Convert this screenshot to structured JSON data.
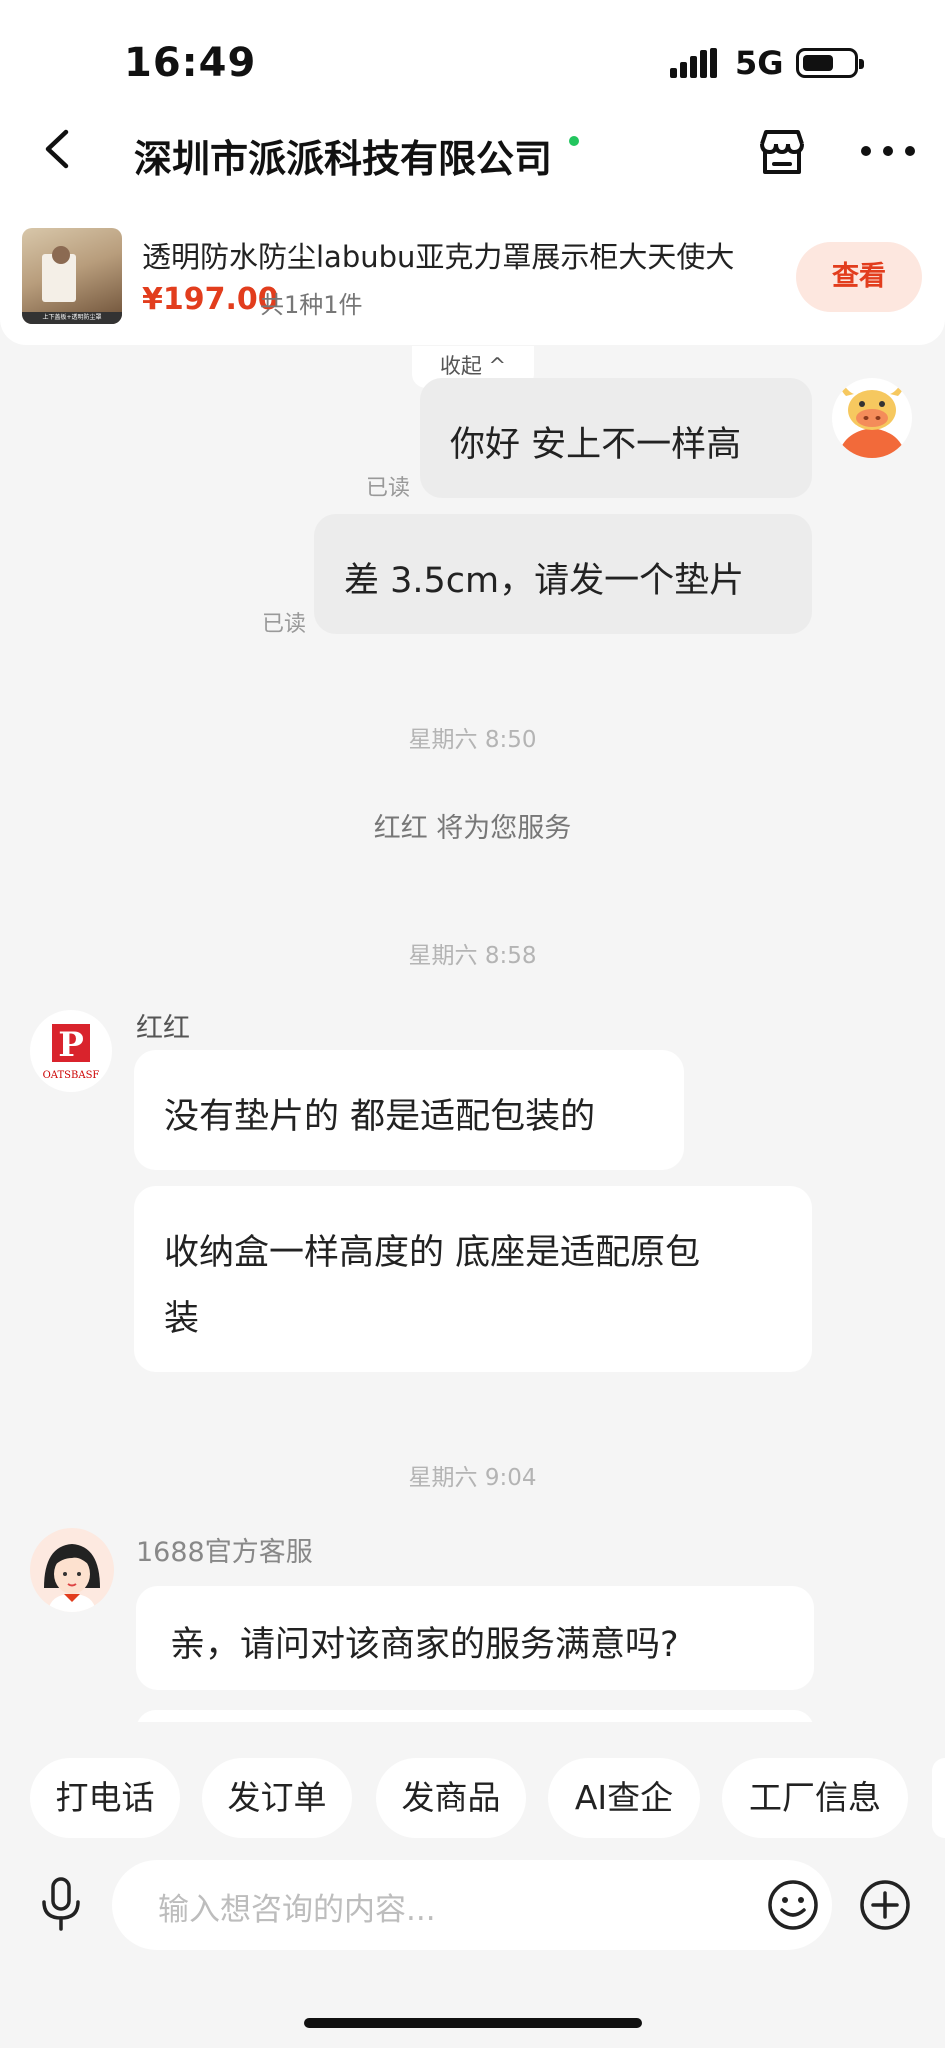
{
  "status_bar": {
    "time": "16:49",
    "network": "5G",
    "icons": [
      "signal-icon",
      "battery-icon"
    ]
  },
  "header": {
    "title": "深圳市派派科技有限公司",
    "online": true,
    "icons": [
      "back-arrow-icon",
      "store-icon",
      "more-icon"
    ]
  },
  "product": {
    "title": "透明防水防尘labubu亚克力罩展示柜大天使大",
    "price": "¥197.00",
    "count": "共1种1件",
    "view_label": "查看"
  },
  "collapse_label": "收起 ^",
  "messages": {
    "m1": {
      "text": "你好 安上不一样高",
      "read": "已读"
    },
    "m2": {
      "text": "差 3.5cm，请发一个垫片",
      "read": "已读"
    },
    "time1": "星期六 8:50",
    "service_notice": "红红  将为您服务",
    "time2": "星期六 8:58",
    "shop_name": "红红",
    "shop_logo_text": "OATSBASF",
    "m3": {
      "text": "没有垫片的 都是适配包装的"
    },
    "m4": {
      "line1": "收纳盒一样高度的 底座是适配原包",
      "line2": "装"
    },
    "time3": "星期六 9:04",
    "cs_name": "1688官方客服",
    "m5": {
      "text": "亲，请问对该商家的服务满意吗?"
    }
  },
  "quick_actions": [
    "打电话",
    "发订单",
    "发商品",
    "AI查企",
    "工厂信息"
  ],
  "input": {
    "placeholder": "输入想咨询的内容..."
  },
  "colors": {
    "accent": "#e23d1d",
    "accent_bg": "#fde7df",
    "online": "#22c55e",
    "background": "#f5f5f5"
  }
}
